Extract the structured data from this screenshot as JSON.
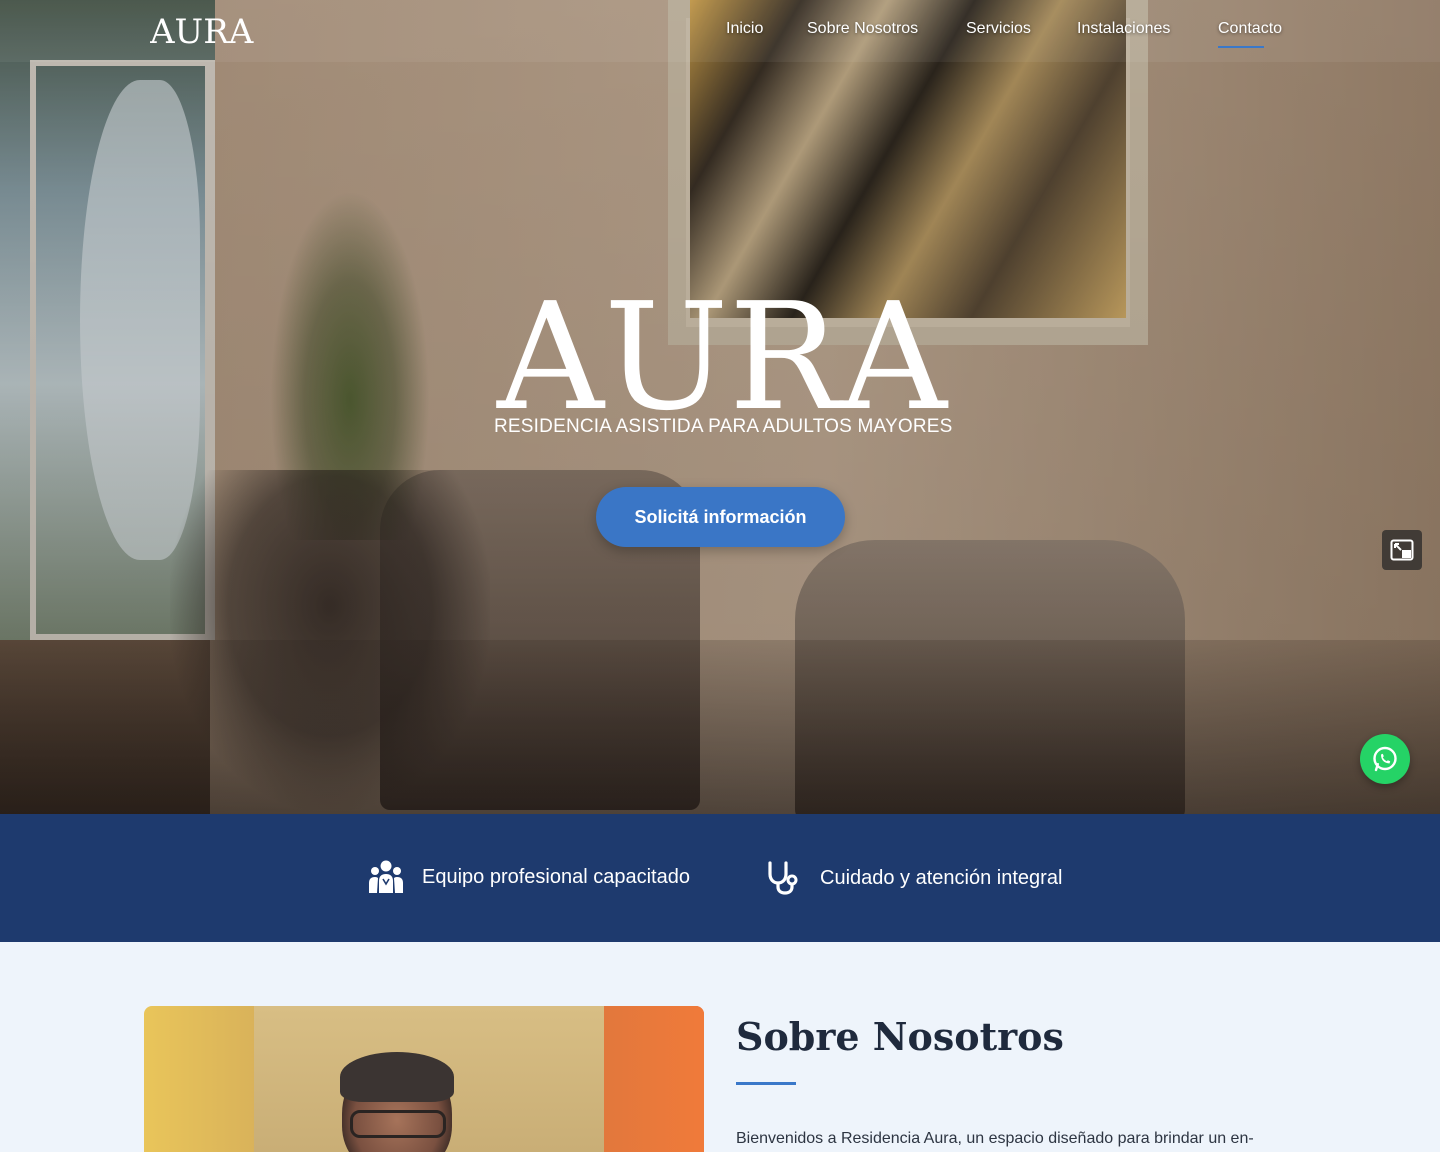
{
  "brand": {
    "logo_text": "AURA"
  },
  "nav": {
    "items": [
      {
        "label": "Inicio"
      },
      {
        "label": "Sobre Nosotros"
      },
      {
        "label": "Servicios"
      },
      {
        "label": "Instalaciones"
      },
      {
        "label": "Contacto"
      }
    ],
    "active": "Contacto"
  },
  "hero": {
    "logo_text": "AURA",
    "tagline": "RESIDENCIA ASISTIDA PARA ADULTOS MAYORES",
    "cta_label": "Solicitá información"
  },
  "features": [
    {
      "icon": "team-icon",
      "label": "Equipo profesional capacitado"
    },
    {
      "icon": "stethoscope-icon",
      "label": "Cuidado y atención integral"
    }
  ],
  "about": {
    "title": "Sobre Nosotros",
    "text": "Bienvenidos a Residencia Aura, un espacio diseñado para brindar un en-"
  },
  "colors": {
    "accent": "#3a76c6",
    "band": "#1e3a6e",
    "whatsapp": "#25d366",
    "page_bg": "#eef4fb"
  }
}
